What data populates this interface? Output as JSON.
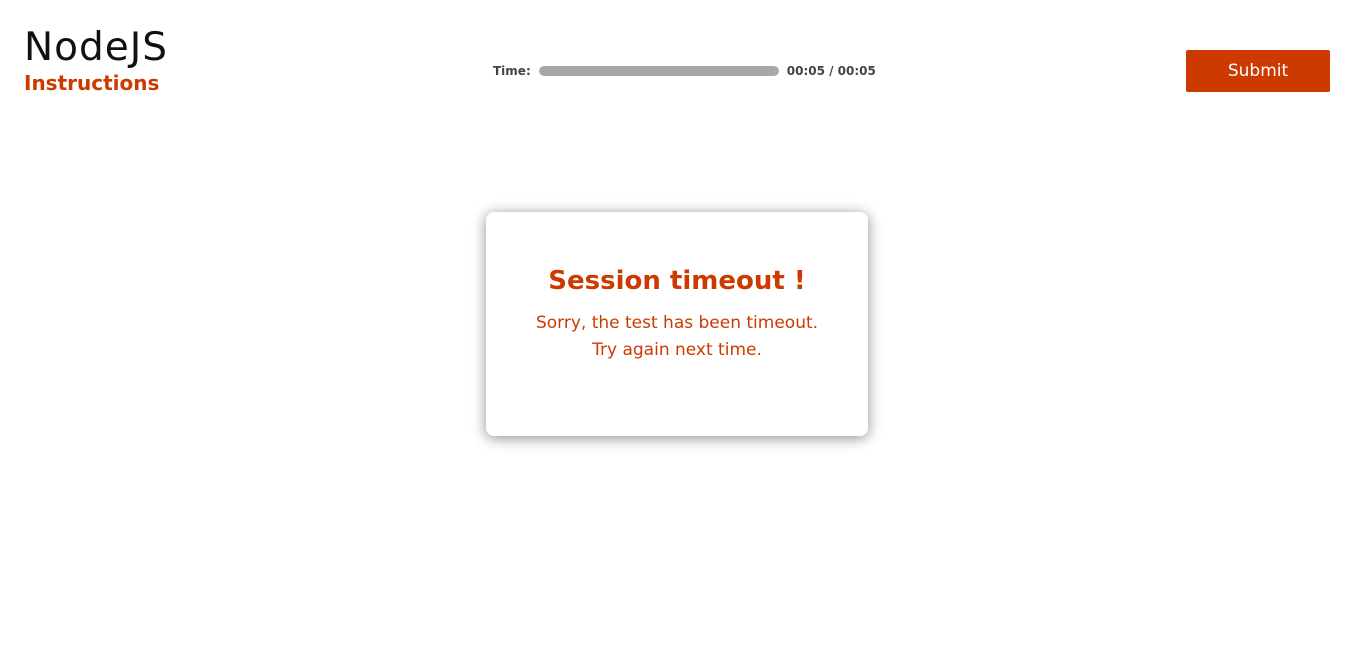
{
  "header": {
    "app_title": "NodeJS",
    "instructions_label": "Instructions",
    "submit_label": "Submit"
  },
  "timer": {
    "label": "Time:",
    "elapsed": "00:05",
    "total": "00:05",
    "readout": "00:05 / 00:05",
    "progress_fraction": 1.0
  },
  "modal": {
    "title": "Session timeout !",
    "line1": "Sorry, the test has been timeout.",
    "line2": "Try again next time."
  },
  "colors": {
    "accent": "#cc3a00",
    "timer_fill": "#a8a8a8",
    "timer_track": "#e2e2e2"
  }
}
